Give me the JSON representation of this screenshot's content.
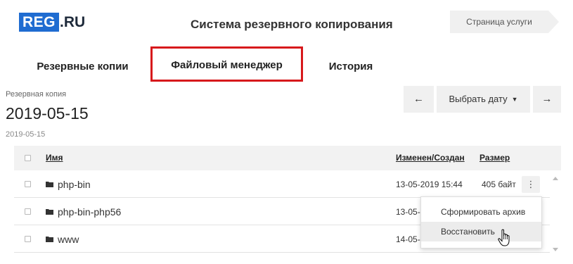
{
  "header": {
    "logo_part1": "REG",
    "logo_part2": ".RU",
    "title": "Система резервного копирования",
    "service_button": "Страница услуги"
  },
  "tabs": [
    {
      "label": "Резервные копии",
      "active": false
    },
    {
      "label": "Файловый менеджер",
      "active": true
    },
    {
      "label": "История",
      "active": false
    }
  ],
  "backup": {
    "label": "Резервная копия",
    "date": "2019-05-15",
    "sub": "2019-05-15"
  },
  "nav": {
    "prev": "←",
    "select_date": "Выбрать дату",
    "next": "→"
  },
  "table": {
    "columns": {
      "name": "Имя",
      "modified": "Изменен/Создан",
      "size": "Размер"
    },
    "rows": [
      {
        "name": "php-bin",
        "modified": "13-05-2019 15:44",
        "size": "405 байт"
      },
      {
        "name": "php-bin-php56",
        "modified": "13-05-",
        "size": ""
      },
      {
        "name": "www",
        "modified": "14-05-",
        "size": ""
      }
    ]
  },
  "context_menu": {
    "make_archive": "Сформировать архив",
    "restore": "Восстановить"
  },
  "colors": {
    "brand_blue": "#1f6cd1",
    "highlight_red": "#d7191c"
  }
}
